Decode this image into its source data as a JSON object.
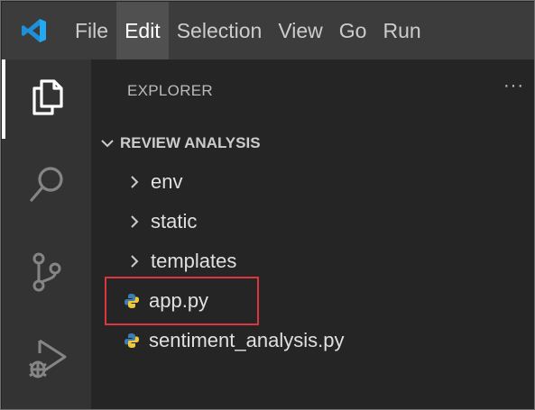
{
  "menubar": {
    "items": [
      "File",
      "Edit",
      "Selection",
      "View",
      "Go",
      "Run"
    ],
    "active": "Edit",
    "logo_icon": "vscode-logo-icon"
  },
  "activitybar": {
    "items": [
      {
        "icon": "files-icon",
        "name": "Explorer",
        "active": true
      },
      {
        "icon": "search-icon",
        "name": "Search",
        "active": false
      },
      {
        "icon": "source-control-icon",
        "name": "Source Control",
        "active": false
      },
      {
        "icon": "run-debug-icon",
        "name": "Run and Debug",
        "active": false
      }
    ]
  },
  "explorer": {
    "title": "EXPLORER",
    "more_label": "···",
    "folder": {
      "name": "REVIEW ANALYSIS",
      "expanded": true
    },
    "items": [
      {
        "name": "env",
        "type": "folder"
      },
      {
        "name": "static",
        "type": "folder"
      },
      {
        "name": "templates",
        "type": "folder"
      },
      {
        "name": "app.py",
        "type": "python-file",
        "highlighted": true
      },
      {
        "name": "sentiment_analysis.py",
        "type": "python-file",
        "highlighted": false
      }
    ]
  },
  "colors": {
    "menubar_bg": "#3c3c3c",
    "activitybar_bg": "#333333",
    "sidebar_bg": "#252526",
    "highlight_border": "#d9363e",
    "vscode_blue": "#23a9f2",
    "python_blue": "#3e7cb1",
    "python_yellow": "#f0c83c"
  }
}
